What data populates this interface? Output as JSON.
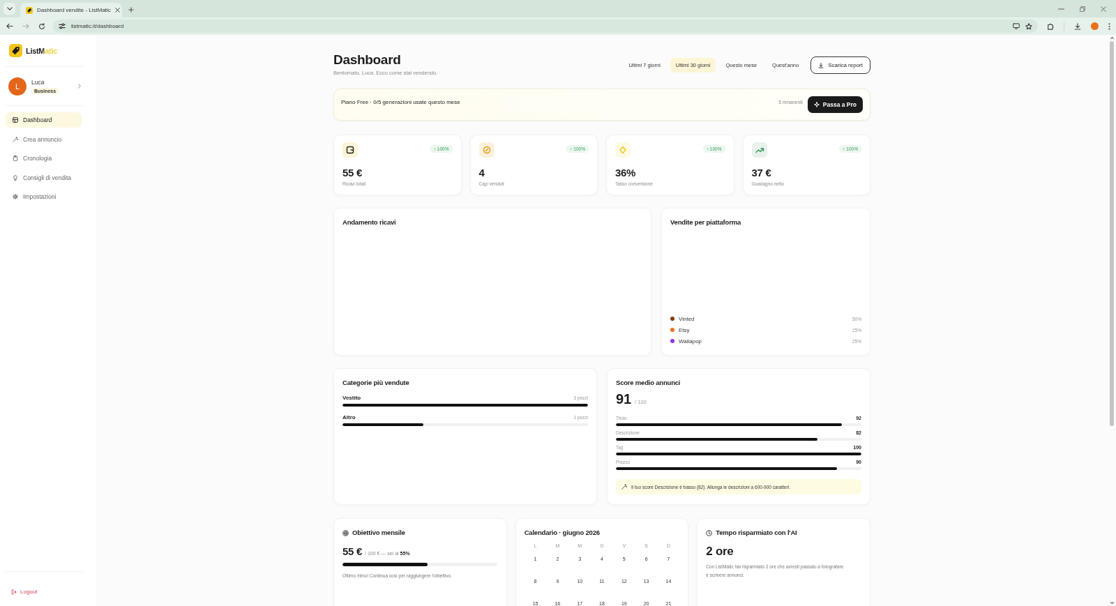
{
  "browser": {
    "tab_title": "Dashboard vendite - ListMatic",
    "url": "listmatic.it/dashboard"
  },
  "sidebar": {
    "brand": "ListMatic",
    "user": {
      "initial": "L",
      "name": "Luca",
      "plan": "Business"
    },
    "nav": [
      {
        "label": "Dashboard",
        "selected": true
      },
      {
        "label": "Crea annuncio",
        "selected": false
      },
      {
        "label": "Cronologia",
        "selected": false
      },
      {
        "label": "Consigli di vendita",
        "selected": false
      },
      {
        "label": "Impostazioni",
        "selected": false
      }
    ],
    "logout": "Logout"
  },
  "header": {
    "title": "Dashboard",
    "subtitle": "Bentornato, Luca. Ecco come stai vendendo.",
    "periods": [
      {
        "label": "Ultimi 7 giorni",
        "selected": false
      },
      {
        "label": "Ultimi 30 giorni",
        "selected": true
      },
      {
        "label": "Questo mese",
        "selected": false
      },
      {
        "label": "Quest'anno",
        "selected": false
      }
    ],
    "report_button": "Scarica report"
  },
  "plan_banner": {
    "text": "Piano Free · 0/5 generazioni usate questo mese",
    "remaining": "5 rimanenti",
    "upgrade_button": "Passa a Pro"
  },
  "stats": [
    {
      "value": "55 €",
      "label": "Ricavi totali",
      "change": "↑ 100%"
    },
    {
      "value": "4",
      "label": "Capi venduti",
      "change": "↑ 100%"
    },
    {
      "value": "36%",
      "label": "Tasso conversione",
      "change": "↑ 100%"
    },
    {
      "value": "37 €",
      "label": "Guadagno netto",
      "change": "↑ 100%"
    }
  ],
  "revenue_chart": {
    "title": "Andamento ricavi"
  },
  "platform_sales": {
    "title": "Vendite per piattaforma",
    "legend": [
      {
        "name": "Vinted",
        "share": "50%",
        "color": "#8a3a10"
      },
      {
        "name": "Etsy",
        "share": "25%",
        "color": "#ee6f1c"
      },
      {
        "name": "Wallapop",
        "share": "25%",
        "color": "#9333ea"
      }
    ]
  },
  "top_categories": {
    "title": "Categorie più vendute",
    "items": [
      {
        "name": "Vestito",
        "count": "3 pezzi",
        "level": 1
      },
      {
        "name": "Altro",
        "count": "1 pezzi",
        "level": 0.33
      }
    ]
  },
  "listing_score": {
    "title": "Score medio annunci",
    "score": "91",
    "max": "/ 100",
    "items": [
      {
        "name": "Titolo",
        "value": "92",
        "level": 0.92
      },
      {
        "name": "Descrizione",
        "value": "82",
        "level": 0.82
      },
      {
        "name": "Tag",
        "value": "100",
        "level": 1
      },
      {
        "name": "Prezzo",
        "value": "90",
        "level": 0.9
      }
    ],
    "tip": "Il tuo score Descrizione è basso (82). Allunga le descrizioni a 600-900 caratteri."
  },
  "monthly_goal": {
    "title": "Obiettivo mensile",
    "value": "55 €",
    "target": "/ 100 € — sei al **55%**",
    "level": 0.55,
    "note": "Ottimo ritmo! Continua così per raggiungere l'obiettivo."
  },
  "calendar": {
    "title": "Calendario · giugno 2026",
    "weekdays": [
      "L",
      "M",
      "M",
      "G",
      "V",
      "S",
      "D"
    ],
    "days": [
      "1",
      "2",
      "3",
      "4",
      "5",
      "6",
      "7",
      "8",
      "9",
      "10",
      "11",
      "12",
      "13",
      "14",
      "15",
      "16",
      "17",
      "18",
      "19",
      "20",
      "21"
    ]
  },
  "time_saved": {
    "title": "Tempo risparmiato con l'AI",
    "value": "2 ore",
    "text": "Con ListMatic hai risparmiato 2 ore che avresti passato a fotografare e scrivere annunci."
  }
}
